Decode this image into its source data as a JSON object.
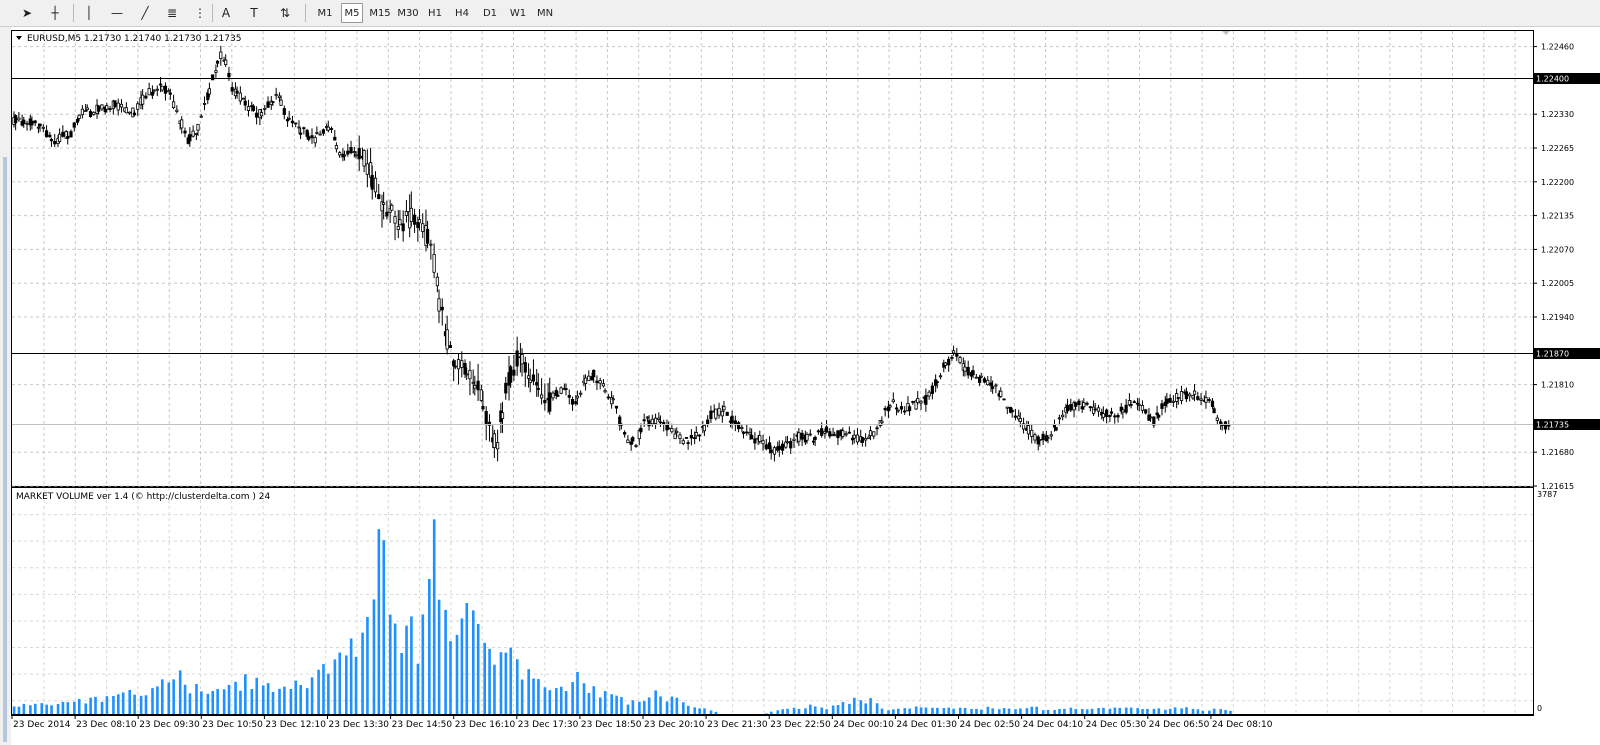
{
  "toolbar": {
    "tools": [
      {
        "name": "cursor-tool",
        "glyph": "➤"
      },
      {
        "name": "crosshair-tool",
        "glyph": "┼"
      },
      {
        "name": "vertical-line-tool",
        "glyph": "│"
      },
      {
        "name": "horizontal-line-tool",
        "glyph": "—"
      },
      {
        "name": "trendline-tool",
        "glyph": "╱"
      },
      {
        "name": "equidistant-channel-tool",
        "glyph": "≣"
      },
      {
        "name": "fibonacci-tool",
        "glyph": "⋮"
      },
      {
        "name": "text-tool",
        "glyph": "A"
      },
      {
        "name": "text-label-tool",
        "glyph": "T"
      },
      {
        "name": "arrows-tool",
        "glyph": "⇅"
      }
    ],
    "timeframes": [
      "M1",
      "M5",
      "M15",
      "M30",
      "H1",
      "H4",
      "D1",
      "W1",
      "MN"
    ],
    "active_timeframe": "M5"
  },
  "chart_header": {
    "symbol_line": "EURUSD,M5  1.21730 1.21740 1.21730 1.21735"
  },
  "indicator_header": {
    "text": "MARKET VOLUME ver 1.4 (© http://clusterdelta.com ) 24"
  },
  "price_axis": {
    "ticks": [
      "1.22460",
      "1.22330",
      "1.22265",
      "1.22200",
      "1.22135",
      "1.22070",
      "1.22005",
      "1.21940",
      "1.21810",
      "1.21680",
      "1.21615"
    ],
    "hline_labels": [
      "1.22400",
      "1.21870"
    ],
    "bid_label": "1.21735",
    "colors": {
      "hline": "#000000",
      "bid_line": "#c0c0c0",
      "label_bg": "#000000",
      "label_fg": "#ffffff"
    }
  },
  "volume_axis": {
    "max_label": "3787",
    "min_label": "0"
  },
  "time_axis": {
    "labels": [
      "23 Dec 2014",
      "23 Dec 08:10",
      "23 Dec 09:30",
      "23 Dec 10:50",
      "23 Dec 12:10",
      "23 Dec 13:30",
      "23 Dec 14:50",
      "23 Dec 16:10",
      "23 Dec 17:30",
      "23 Dec 18:50",
      "23 Dec 20:10",
      "23 Dec 21:30",
      "23 Dec 22:50",
      "24 Dec 00:10",
      "24 Dec 01:30",
      "24 Dec 02:50",
      "24 Dec 04:10",
      "24 Dec 05:30",
      "24 Dec 06:50",
      "24 Dec 08:10"
    ]
  },
  "chart_data": [
    {
      "type": "candlestick",
      "symbol": "EURUSD",
      "timeframe": "M5",
      "ylim": [
        1.21615,
        1.2249
      ],
      "hlines": [
        1.224,
        1.2187
      ],
      "bid": 1.21735,
      "grid": true,
      "close_path": [
        [
          0,
          1.2232
        ],
        [
          8,
          1.22315
        ],
        [
          18,
          1.223
        ],
        [
          24,
          1.2228
        ],
        [
          34,
          1.2229
        ],
        [
          42,
          1.2233
        ],
        [
          52,
          1.2234
        ],
        [
          62,
          1.2235
        ],
        [
          72,
          1.2233
        ],
        [
          82,
          1.2237
        ],
        [
          92,
          1.22385
        ],
        [
          100,
          1.2234
        ],
        [
          106,
          1.2228
        ],
        [
          112,
          1.223
        ],
        [
          118,
          1.2235
        ],
        [
          124,
          1.2242
        ],
        [
          128,
          1.2245
        ],
        [
          134,
          1.2238
        ],
        [
          142,
          1.2235
        ],
        [
          150,
          1.2233
        ],
        [
          156,
          1.22345
        ],
        [
          162,
          1.2237
        ],
        [
          168,
          1.2232
        ],
        [
          176,
          1.223
        ],
        [
          184,
          1.2228
        ],
        [
          194,
          1.2231
        ],
        [
          200,
          1.2225
        ],
        [
          208,
          1.2226
        ],
        [
          216,
          1.2224
        ],
        [
          222,
          1.2219
        ],
        [
          228,
          1.2215
        ],
        [
          236,
          1.2212
        ],
        [
          244,
          1.2213
        ],
        [
          252,
          1.2211
        ],
        [
          258,
          1.2204
        ],
        [
          262,
          1.2195
        ],
        [
          266,
          1.219
        ],
        [
          270,
          1.2186
        ],
        [
          276,
          1.2184
        ],
        [
          282,
          1.2182
        ],
        [
          288,
          1.2178
        ],
        [
          292,
          1.2172
        ],
        [
          296,
          1.2169
        ],
        [
          300,
          1.2176
        ],
        [
          304,
          1.2183
        ],
        [
          310,
          1.2186
        ],
        [
          316,
          1.2184
        ],
        [
          320,
          1.218
        ],
        [
          326,
          1.2177
        ],
        [
          332,
          1.2179
        ],
        [
          338,
          1.218
        ],
        [
          344,
          1.2177
        ],
        [
          350,
          1.2181
        ],
        [
          356,
          1.2183
        ],
        [
          364,
          1.218
        ],
        [
          370,
          1.2176
        ],
        [
          376,
          1.217
        ],
        [
          382,
          1.217
        ],
        [
          388,
          1.2174
        ],
        [
          396,
          1.2174
        ],
        [
          404,
          1.2172
        ],
        [
          412,
          1.217
        ],
        [
          420,
          1.2171
        ],
        [
          428,
          1.2175
        ],
        [
          436,
          1.2176
        ],
        [
          444,
          1.2173
        ],
        [
          452,
          1.2171
        ],
        [
          460,
          1.217
        ],
        [
          466,
          1.21685
        ],
        [
          474,
          1.2169
        ],
        [
          482,
          1.2171
        ],
        [
          490,
          1.21705
        ],
        [
          498,
          1.2172
        ],
        [
          506,
          1.21715
        ],
        [
          514,
          1.2171
        ],
        [
          522,
          1.217
        ],
        [
          528,
          1.2172
        ],
        [
          534,
          1.2175
        ],
        [
          540,
          1.2178
        ],
        [
          546,
          1.2176
        ],
        [
          552,
          1.2177
        ],
        [
          560,
          1.2178
        ],
        [
          566,
          1.2181
        ],
        [
          572,
          1.2185
        ],
        [
          578,
          1.2187
        ],
        [
          584,
          1.2184
        ],
        [
          592,
          1.2182
        ],
        [
          600,
          1.2181
        ],
        [
          606,
          1.2179
        ],
        [
          612,
          1.2176
        ],
        [
          618,
          1.2174
        ],
        [
          624,
          1.2172
        ],
        [
          630,
          1.217
        ],
        [
          636,
          1.21715
        ],
        [
          642,
          1.2174
        ],
        [
          648,
          1.2177
        ],
        [
          654,
          1.2177
        ],
        [
          660,
          1.21765
        ],
        [
          668,
          1.21755
        ],
        [
          674,
          1.2175
        ],
        [
          682,
          1.2176
        ],
        [
          688,
          1.2178
        ],
        [
          694,
          1.2176
        ],
        [
          700,
          1.2174
        ],
        [
          706,
          1.2177
        ],
        [
          712,
          1.2178
        ],
        [
          718,
          1.2179
        ],
        [
          724,
          1.2179
        ],
        [
          730,
          1.2178
        ],
        [
          736,
          1.2177
        ],
        [
          742,
          1.2173
        ],
        [
          748,
          1.21735
        ]
      ],
      "approx_points": 748
    },
    {
      "type": "bar",
      "title": "MARKET VOLUME ver 1.4",
      "ylim": [
        0,
        3787
      ],
      "color": "#1e90ff",
      "volume_path": [
        [
          0,
          150
        ],
        [
          20,
          200
        ],
        [
          40,
          250
        ],
        [
          60,
          300
        ],
        [
          70,
          600
        ],
        [
          80,
          350
        ],
        [
          90,
          500
        ],
        [
          100,
          900
        ],
        [
          110,
          450
        ],
        [
          120,
          550
        ],
        [
          130,
          450
        ],
        [
          140,
          600
        ],
        [
          150,
          700
        ],
        [
          160,
          500
        ],
        [
          170,
          450
        ],
        [
          180,
          650
        ],
        [
          190,
          900
        ],
        [
          200,
          1100
        ],
        [
          210,
          1300
        ],
        [
          215,
          1800
        ],
        [
          220,
          2600
        ],
        [
          224,
          3787
        ],
        [
          228,
          2700
        ],
        [
          232,
          2100
        ],
        [
          236,
          1600
        ],
        [
          240,
          1400
        ],
        [
          244,
          1800
        ],
        [
          248,
          1300
        ],
        [
          252,
          1700
        ],
        [
          256,
          2700
        ],
        [
          260,
          3250
        ],
        [
          264,
          2300
        ],
        [
          268,
          1600
        ],
        [
          272,
          1300
        ],
        [
          276,
          2200
        ],
        [
          280,
          2700
        ],
        [
          284,
          1700
        ],
        [
          288,
          1200
        ],
        [
          292,
          1700
        ],
        [
          296,
          1000
        ],
        [
          300,
          1200
        ],
        [
          304,
          1400
        ],
        [
          310,
          900
        ],
        [
          316,
          700
        ],
        [
          322,
          600
        ],
        [
          330,
          500
        ],
        [
          340,
          450
        ],
        [
          345,
          900
        ],
        [
          352,
          500
        ],
        [
          360,
          400
        ],
        [
          368,
          300
        ],
        [
          376,
          250
        ],
        [
          384,
          200
        ],
        [
          392,
          450
        ],
        [
          398,
          300
        ],
        [
          404,
          350
        ],
        [
          410,
          200
        ],
        [
          416,
          120
        ],
        [
          422,
          100
        ],
        [
          428,
          80
        ],
        [
          434,
          0
        ],
        [
          440,
          0
        ],
        [
          460,
          0
        ],
        [
          470,
          80
        ],
        [
          480,
          100
        ],
        [
          490,
          150
        ],
        [
          500,
          100
        ],
        [
          510,
          200
        ],
        [
          520,
          300
        ],
        [
          526,
          250
        ],
        [
          532,
          120
        ],
        [
          540,
          80
        ],
        [
          550,
          100
        ],
        [
          560,
          150
        ],
        [
          570,
          120
        ],
        [
          580,
          100
        ],
        [
          590,
          80
        ],
        [
          600,
          120
        ],
        [
          610,
          100
        ],
        [
          620,
          150
        ],
        [
          630,
          100
        ],
        [
          640,
          80
        ],
        [
          650,
          100
        ],
        [
          660,
          80
        ],
        [
          670,
          100
        ],
        [
          680,
          150
        ],
        [
          690,
          100
        ],
        [
          700,
          80
        ],
        [
          710,
          100
        ],
        [
          720,
          120
        ],
        [
          730,
          80
        ],
        [
          740,
          100
        ],
        [
          748,
          60
        ]
      ]
    }
  ]
}
